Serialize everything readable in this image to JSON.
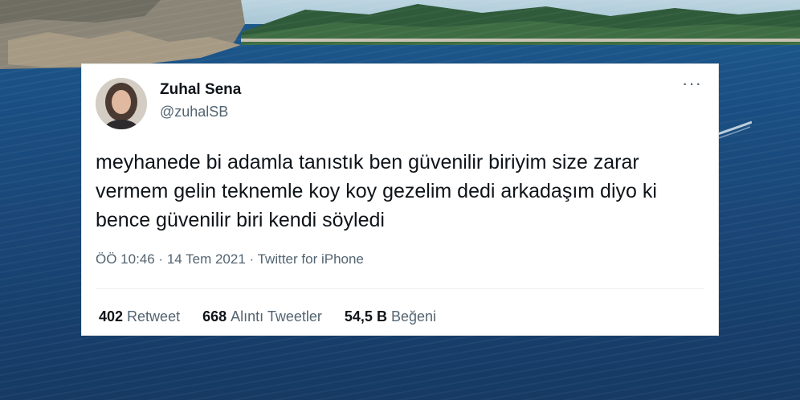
{
  "tweet": {
    "display_name": "Zuhal Sena",
    "handle": "@zuhalSB",
    "more_label": "···",
    "text": "meyhanede bi adamla tanıstık ben güvenilir biriyim size zarar vermem gelin teknemle koy koy gezelim dedi arkadaşım diyo ki bence güvenilir biri kendi söyledi",
    "meta": "ÖÖ 10:46 · 14 Tem 2021 · Twitter for iPhone",
    "stats": [
      {
        "count": "402",
        "label": "Retweet"
      },
      {
        "count": "668",
        "label": "Alıntı Tweetler"
      },
      {
        "count": "54,5 B",
        "label": "Beğeni"
      }
    ]
  },
  "colors": {
    "text_primary": "#0f1419",
    "text_secondary": "#536471",
    "sea": "#1a4677"
  }
}
